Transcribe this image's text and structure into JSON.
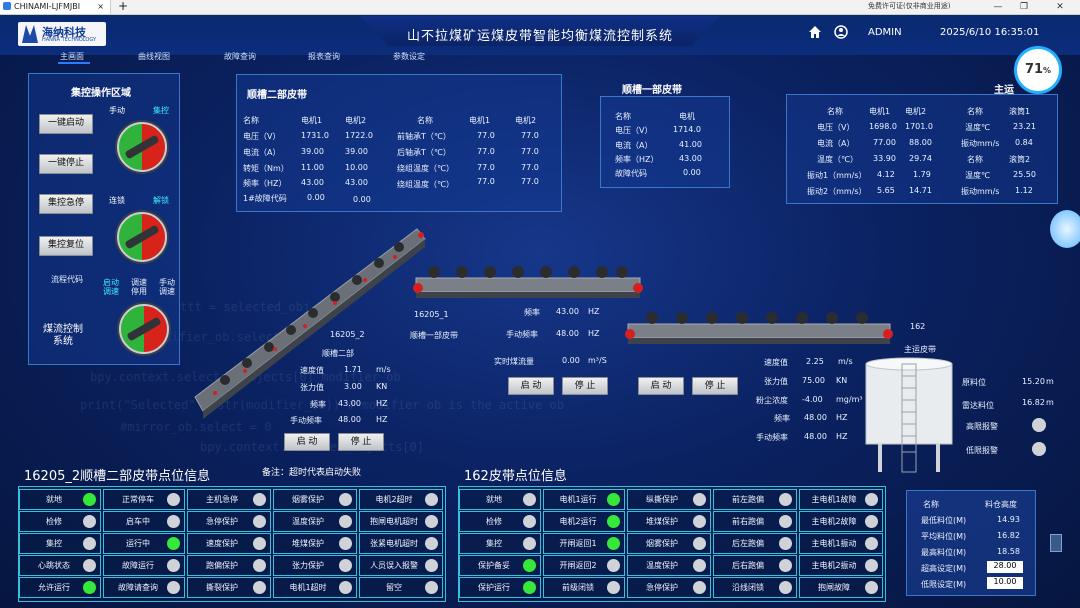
{
  "browser": {
    "tab_title": "CHINAMI-LJFMJBI",
    "tab_close": "×",
    "new_tab": "+",
    "license_note": "免费许可证(仅非商业用途)",
    "min": "—",
    "max": "❐",
    "close": "✕"
  },
  "app": {
    "title": "山不拉煤矿运煤皮带智能均衡煤流控制系统",
    "logo_cn": "海纳科技",
    "logo_en": "HANNA TECHNOLOGY",
    "user": "ADMIN",
    "datetime": "2025/6/10 16:35:01",
    "cpu_pct": "71",
    "pct_sign": "%"
  },
  "nav": [
    "主画面",
    "曲线视图",
    "故障查询",
    "报表查询",
    "参数设定"
  ],
  "control": {
    "title": "集控操作区域",
    "btn_start": "一键启动",
    "btn_stop": "一键停止",
    "btn_estop": "集控急停",
    "btn_reset": "集控复位",
    "lbl_manual": "手动",
    "lbl_central": "集控",
    "lbl_link": "连锁",
    "lbl_unlock": "解锁",
    "lbl_flow_code": "流程代码",
    "lbl_start_adj": "启动\n调速",
    "lbl_adj_stop": "调速\n停用",
    "lbl_manual_adj": "手动\n调速",
    "lbl_flow_sys": "煤流控制\n系统"
  },
  "panel_sc2": {
    "title": "顺槽二部皮带",
    "head": [
      "名称",
      "电机1",
      "电机2"
    ],
    "rows": [
      [
        "电压（V）",
        "1731.0",
        "1722.0"
      ],
      [
        "电流（A）",
        "39.00",
        "39.00"
      ],
      [
        "转矩（Nm）",
        "11.00",
        "10.00"
      ],
      [
        "频率（HZ）",
        "43.00",
        "43.00"
      ],
      [
        "1#故障代码",
        "0.00",
        "0.00"
      ]
    ],
    "head2": [
      "名称",
      "电机1",
      "电机2"
    ],
    "rows2": [
      [
        "前轴承T（℃）",
        "77.0",
        "77.0"
      ],
      [
        "后轴承T（℃）",
        "77.0",
        "77.0"
      ],
      [
        "绕组温度（℃）",
        "77.0",
        "77.0"
      ],
      [
        "绕组温度（℃）",
        "77.0",
        "77.0"
      ]
    ]
  },
  "panel_sc1": {
    "title": "顺槽一部皮带",
    "head": [
      "名称",
      "电机"
    ],
    "rows": [
      [
        "电压（V）",
        "1714.0"
      ],
      [
        "电流（A）",
        "41.00"
      ],
      [
        "频率（HZ）",
        "43.00"
      ],
      [
        "故障代码",
        "0.00"
      ]
    ]
  },
  "panel_main": {
    "title": "主运",
    "head": [
      "名称",
      "电机1",
      "电机2"
    ],
    "rows": [
      [
        "电压（V）",
        "1698.0",
        "1701.0"
      ],
      [
        "电流（A）",
        "77.00",
        "88.00"
      ],
      [
        "温度（℃）",
        "33.90",
        "29.74"
      ],
      [
        "振动1（mm/s）",
        "4.12",
        "1.79"
      ],
      [
        "振动2（mm/s）",
        "5.65",
        "14.71"
      ]
    ],
    "head2": [
      "名称",
      "滚筒1"
    ],
    "rows2": [
      [
        "温度℃",
        "23.21"
      ],
      [
        "振动mm/s",
        "0.84"
      ]
    ],
    "head3": [
      "名称",
      "滚筒2"
    ],
    "rows3": [
      [
        "温度℃",
        "25.50"
      ],
      [
        "振动mm/s",
        "1.12"
      ]
    ]
  },
  "belt_16205_2": {
    "code": "16205_2",
    "name": "顺槽二部",
    "rows": [
      [
        "速度值",
        "1.71",
        "m/s"
      ],
      [
        "张力值",
        "3.00",
        "KN"
      ],
      [
        "频率",
        "43.00",
        "HZ"
      ],
      [
        "手动频率",
        "48.00",
        "HZ"
      ]
    ],
    "btn_start": "启 动",
    "btn_stop": "停 止"
  },
  "belt_16205_1": {
    "code": "16205_1",
    "name": "顺槽一部皮带",
    "rows": [
      [
        "频率",
        "43.00",
        "HZ"
      ],
      [
        "手动频率",
        "48.00",
        "HZ"
      ]
    ],
    "flow_label": "实时煤流量",
    "flow_value": "0.00",
    "flow_unit": "m³/S",
    "btn_start": "启 动",
    "btn_stop": "停 止"
  },
  "belt_162": {
    "code": "162",
    "name": "主运皮带",
    "rows": [
      [
        "速度值",
        "2.25",
        "m/s"
      ],
      [
        "张力值",
        "75.00",
        "KN"
      ],
      [
        "粉尘浓度",
        "-4.00",
        "mg/m³"
      ],
      [
        "频率",
        "48.00",
        "HZ"
      ],
      [
        "手动频率",
        "48.00",
        "HZ"
      ]
    ],
    "btn_start": "启 动",
    "btn_stop": "停 止"
  },
  "bunker": {
    "rows": [
      [
        "原料位",
        "15.20",
        "m"
      ],
      [
        "雷达料位",
        "16.82",
        "m"
      ]
    ],
    "alarm_high": "高限报警",
    "alarm_low": "低限报警"
  },
  "points_a": {
    "title": "16205_2顺槽二部皮带点位信息",
    "note": "备注：超时代表启动失败",
    "cols": [
      [
        [
          "就地",
          true
        ],
        [
          "检修",
          false
        ],
        [
          "集控",
          false
        ],
        [
          "心跳状态",
          false
        ],
        [
          "允许运行",
          true
        ]
      ],
      [
        [
          "正常停车",
          false
        ],
        [
          "启车中",
          false
        ],
        [
          "运行中",
          true
        ],
        [
          "故障运行",
          false
        ],
        [
          "故障请查询",
          false
        ]
      ],
      [
        [
          "主机急停",
          false
        ],
        [
          "急停保护",
          false
        ],
        [
          "速度保护",
          false
        ],
        [
          "跑偏保护",
          false
        ],
        [
          "撕裂保护",
          false
        ]
      ],
      [
        [
          "烟雾保护",
          false
        ],
        [
          "温度保护",
          false
        ],
        [
          "堆煤保护",
          false
        ],
        [
          "张力保护",
          false
        ],
        [
          "电机1超时",
          false
        ]
      ],
      [
        [
          "电机2超时",
          false
        ],
        [
          "抱闸电机超时",
          false
        ],
        [
          "张紧电机超时",
          false
        ],
        [
          "人员误入报警",
          false
        ],
        [
          "留空",
          false
        ]
      ]
    ]
  },
  "points_b": {
    "title": "162皮带点位信息",
    "cols": [
      [
        [
          "就地",
          false
        ],
        [
          "检修",
          false
        ],
        [
          "集控",
          false
        ],
        [
          "保护备妥",
          true
        ],
        [
          "保护运行",
          true
        ]
      ],
      [
        [
          "电机1运行",
          true
        ],
        [
          "电机2运行",
          true
        ],
        [
          "开闸返回1",
          true
        ],
        [
          "开闸返回2",
          false
        ],
        [
          "前级闭锁",
          false
        ]
      ],
      [
        [
          "纵撕保护",
          false
        ],
        [
          "堆煤保护",
          false
        ],
        [
          "烟雾保护",
          false
        ],
        [
          "温度保护",
          false
        ],
        [
          "急停保护",
          false
        ]
      ],
      [
        [
          "前左跑偏",
          false
        ],
        [
          "前右跑偏",
          false
        ],
        [
          "后左跑偏",
          false
        ],
        [
          "后右跑偏",
          false
        ],
        [
          "沿线闭锁",
          false
        ]
      ],
      [
        [
          "主电机1故障",
          false
        ],
        [
          "主电机2故障",
          false
        ],
        [
          "主电机1振动",
          false
        ],
        [
          "主电机2振动",
          false
        ],
        [
          "抱闸故障",
          false
        ]
      ]
    ]
  },
  "level_table": {
    "head": [
      "名称",
      "料仓高度"
    ],
    "rows": [
      [
        "最低料位(M)",
        "14.93"
      ],
      [
        "平均料位(M)",
        "16.82"
      ],
      [
        "最高料位(M)",
        "18.58"
      ]
    ],
    "set_rows": [
      [
        "超高设定(M)",
        "28.00"
      ],
      [
        "低限设定(M)",
        "10.00"
      ]
    ]
  },
  "watermark": [
    "ttt = selected_obj",
    "modifier_ob.select",
    "bpy.context.selected_objects[0]  modifier_ob",
    "print(\"Selected\" + str(modifier_ob)) # modifier ob is the active ob",
    "#mirror_ob.select = 0",
    "bpy.context.selected_objects[0]"
  ]
}
